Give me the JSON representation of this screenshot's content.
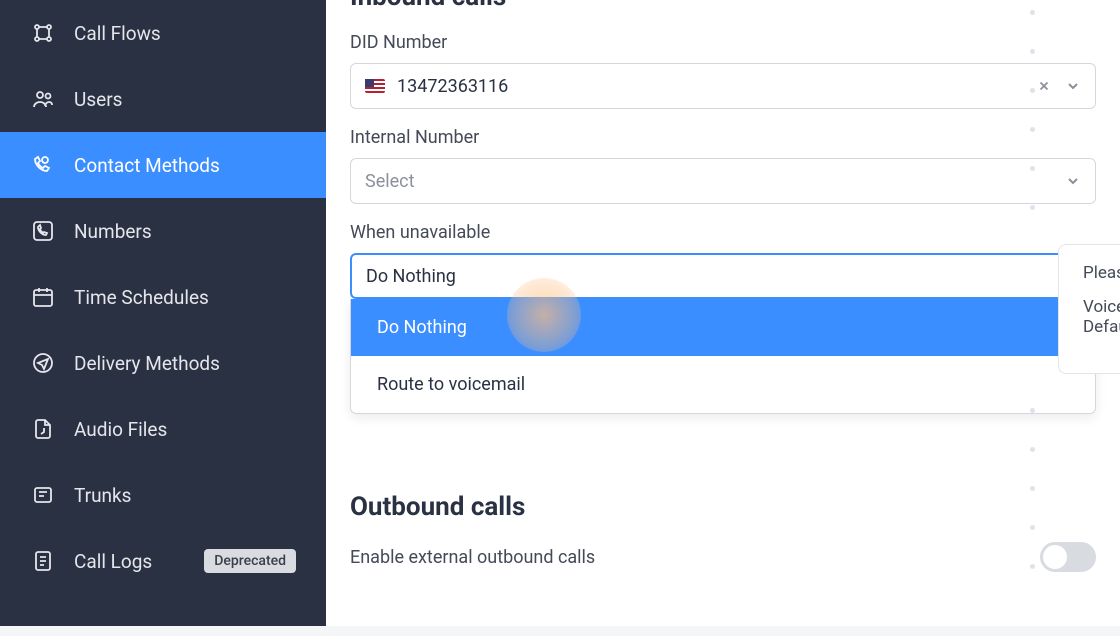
{
  "sidebar": {
    "items": [
      {
        "label": "Call Flows"
      },
      {
        "label": "Users"
      },
      {
        "label": "Contact Methods"
      },
      {
        "label": "Numbers"
      },
      {
        "label": "Time Schedules"
      },
      {
        "label": "Delivery Methods"
      },
      {
        "label": "Audio Files"
      },
      {
        "label": "Trunks"
      },
      {
        "label": "Call Logs",
        "badge": "Deprecated"
      }
    ]
  },
  "main": {
    "inbound_title": "Inbound calls",
    "did_label": "DID Number",
    "did_value": "13472363116",
    "internal_label": "Internal Number",
    "internal_placeholder": "Select",
    "unavailable_label": "When unavailable",
    "unavailable_value": "Do Nothing",
    "unavailable_options": [
      "Do Nothing",
      "Route to voicemail"
    ],
    "outbound_title": "Outbound calls",
    "outbound_toggle_label": "Enable external outbound calls"
  },
  "tooltip": {
    "line1": "Please",
    "line2": "Voice",
    "line3": "Defau"
  }
}
